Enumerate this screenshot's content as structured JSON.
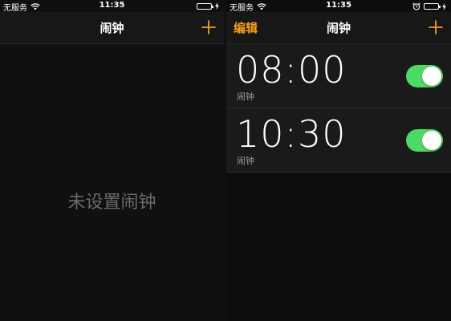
{
  "theme": {
    "accent": "#f6a01e",
    "switch_on": "#4cd964",
    "background": "#0f0f0f"
  },
  "screens": [
    {
      "status_bar": {
        "carrier": "无服务",
        "time": "11:35"
      },
      "nav": {
        "title": "闹钟",
        "add_icon": "plus-icon"
      },
      "empty_message": "未设置闹钟"
    },
    {
      "status_bar": {
        "carrier": "无服务",
        "time": "11:35"
      },
      "nav": {
        "edit_label": "编辑",
        "title": "闹钟",
        "add_icon": "plus-icon"
      },
      "alarms": [
        {
          "time": "08:00",
          "label": "闹钟",
          "enabled": true
        },
        {
          "time": "10:30",
          "label": "闹钟",
          "enabled": true
        }
      ]
    }
  ]
}
